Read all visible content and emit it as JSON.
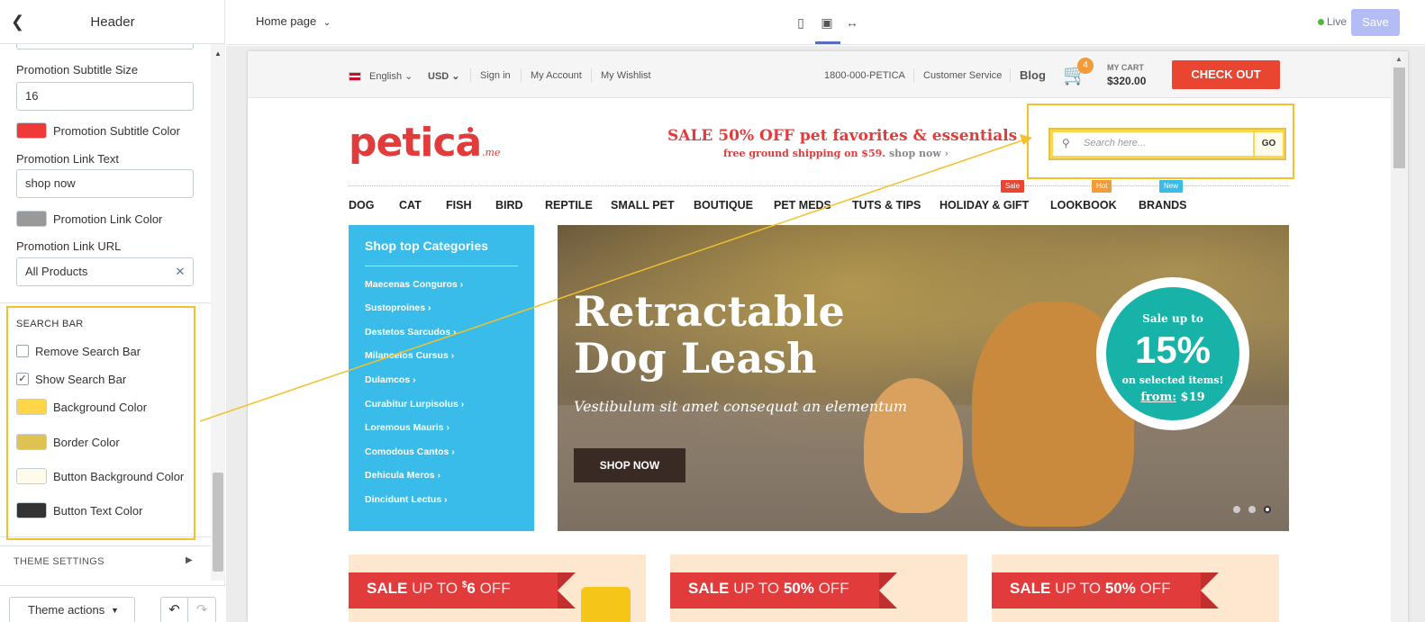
{
  "sidebar": {
    "title": "Header",
    "fields": {
      "subtitle_size_label": "Promotion Subtitle Size",
      "subtitle_size_value": "16",
      "subtitle_color_label": "Promotion Subtitle Color",
      "link_text_label": "Promotion Link Text",
      "link_text_value": "shop now",
      "link_color_label": "Promotion Link Color",
      "link_url_label": "Promotion Link URL",
      "link_url_value": "All Products"
    },
    "search_bar": {
      "title": "SEARCH BAR",
      "remove_label": "Remove Search Bar",
      "show_label": "Show Search Bar",
      "bg_color_label": "Background Color",
      "border_color_label": "Border Color",
      "button_bg_label": "Button Background Color",
      "button_text_label": "Button Text Color"
    },
    "theme_settings": "THEME SETTINGS",
    "theme_actions": "Theme actions"
  },
  "topbar": {
    "page_select": "Home page",
    "live": "Live",
    "save": "Save"
  },
  "store": {
    "util": {
      "language": "English",
      "currency": "USD",
      "sign_in": "Sign in",
      "my_account": "My Account",
      "my_wishlist": "My Wishlist",
      "phone": "1800-000-PETICA",
      "customer_service": "Customer Service",
      "blog": "Blog",
      "cart_count": "4",
      "my_cart": "MY CART",
      "cart_total": "$320.00",
      "checkout": "CHECK OUT"
    },
    "logo": "petica",
    "logo_suffix": ".me",
    "promo_title": "SALE 50% OFF pet favorites & essentials",
    "promo_sub": "free ground shipping on $59.",
    "promo_link": "shop now ›",
    "search_placeholder": "Search here...",
    "search_button": "GO",
    "nav": [
      "DOG",
      "CAT",
      "FISH",
      "BIRD",
      "REPTILE",
      "SMALL PET",
      "BOUTIQUE",
      "PET MEDS",
      "TUTS & TIPS",
      "HOLIDAY & GIFT",
      "LOOKBOOK",
      "BRANDS"
    ],
    "nav_tags": {
      "sale": "Sale",
      "hot": "Hot",
      "new": "New"
    },
    "categories_title": "Shop top Categories",
    "categories": [
      "Maecenas Conguros",
      "Sustoproines",
      "Destetos Sarcudos",
      "Milancelos Cursus",
      "Dulamcos",
      "Curabitur Lurpisolus",
      "Loremous Mauris",
      "Comodous Cantos",
      "Dehicula Meros",
      "Dincidunt Lectus"
    ],
    "hero": {
      "line1": "Retractable",
      "line2": "Dog Leash",
      "subtitle": "Vestibulum sit amet consequat an elementum",
      "button": "SHOP NOW",
      "badge_top": "Sale up to",
      "badge_pct": "15%",
      "badge_mid": "on selected items!",
      "badge_from": "from:",
      "badge_price": "$19"
    },
    "tiles": [
      {
        "strong": "SALE",
        "light": " UP TO ",
        "sup": "$",
        "amount": "6",
        "off": " OFF"
      },
      {
        "strong": "SALE",
        "light": " UP TO ",
        "sup": "",
        "amount": "50%",
        "off": " OFF"
      },
      {
        "strong": "SALE",
        "light": " UP TO ",
        "sup": "",
        "amount": "50%",
        "off": " OFF"
      }
    ]
  },
  "colors": {
    "subtitle_color": "#f03a3a",
    "link_color": "#999999",
    "search_bg": "#ffd54a",
    "search_border": "#dfc251",
    "button_bg": "#fffbeb",
    "button_text": "#333333",
    "accent": "#5c6ac4",
    "highlight": "#f2c12e"
  },
  "icons": {
    "back": "chevron-left-icon",
    "cart": "cart-icon",
    "search": "search-icon",
    "clear": "close-icon",
    "undo": "undo-icon",
    "redo": "redo-icon",
    "mobile": "mobile-icon",
    "desktop": "desktop-icon",
    "fullwidth": "fullwidth-icon"
  }
}
